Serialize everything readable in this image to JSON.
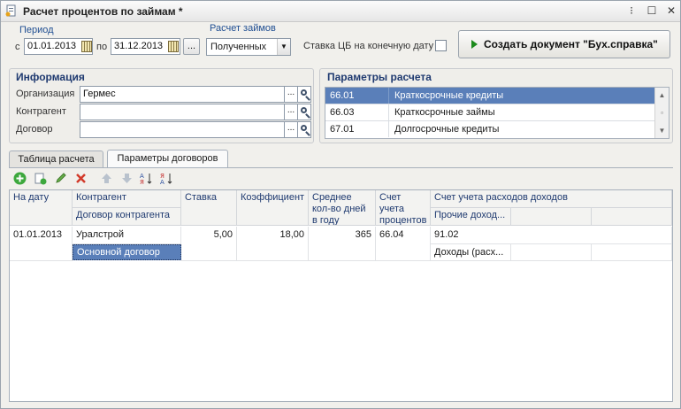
{
  "window": {
    "title": "Расчет процентов по займам *"
  },
  "period": {
    "group_label": "Период",
    "from_label": "с",
    "from_date": "01.01.2013",
    "to_label": "по",
    "to_date": "31.12.2013",
    "more_label": "..."
  },
  "loans_calc": {
    "group_label": "Расчет займов",
    "selected": "Полученных"
  },
  "cb_rate": {
    "label": "Ставка ЦБ на конечную дату"
  },
  "create_doc_button": {
    "label": "Создать документ \"Бух.справка\""
  },
  "info": {
    "title": "Информация",
    "org_label": "Организация",
    "org_value": "Гермес",
    "contractor_label": "Контрагент",
    "contractor_value": "",
    "contract_label": "Договор",
    "contract_value": "",
    "dots": "..."
  },
  "params": {
    "title": "Параметры расчета",
    "rows": [
      {
        "code": "66.01",
        "name": "Краткосрочные кредиты"
      },
      {
        "code": "66.03",
        "name": "Краткосрочные займы"
      },
      {
        "code": "67.01",
        "name": "Долгосрочные кредиты"
      }
    ]
  },
  "tabs": [
    {
      "label": "Таблица расчета"
    },
    {
      "label": "Параметры договоров"
    }
  ],
  "table": {
    "headers": {
      "date": "На дату",
      "contractor": "Контрагент",
      "contract": "Договор контрагента",
      "rate": "Ставка",
      "coef": "Коэффициент",
      "avg_days": "Среднее кол-во дней в году",
      "interest_account": "Счет учета процентов",
      "expense_account": "Счет учета расходов доходов",
      "other_income": "Прочие доход..."
    },
    "rows": [
      {
        "date": "01.01.2013",
        "contractor": "Уралстрой",
        "contract": "Основной договор",
        "rate": "5,00",
        "coef": "18,00",
        "avg_days": "365",
        "interest_account": "66.04",
        "expense_account": "91.02",
        "expense_sub": "Доходы (расх..."
      }
    ]
  },
  "colors": {
    "selection": "#5a7fb9",
    "header_text": "#1f3a70",
    "play_icon": "#1c8a1c"
  }
}
